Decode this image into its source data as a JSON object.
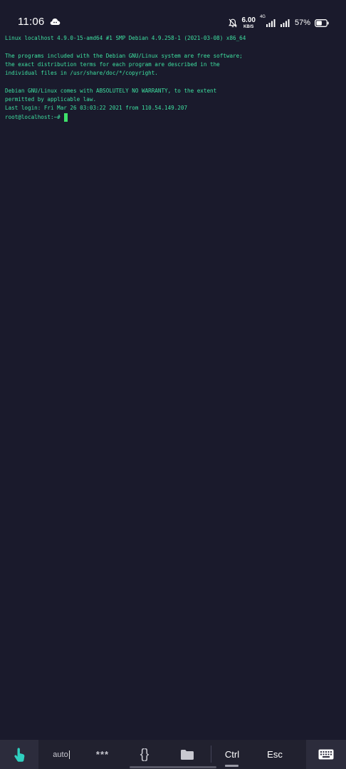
{
  "status_bar": {
    "time": "11:06",
    "net_speed_value": "6.00",
    "net_speed_unit": "KB/S",
    "network_tag": "4G",
    "battery_percent": "57%",
    "battery_level": 0.57,
    "icons": [
      "cloud-icon",
      "bell-muted-icon",
      "signal-icon",
      "signal-icon",
      "battery-icon"
    ]
  },
  "terminal": {
    "lines": [
      "Linux localhost 4.9.0-15-amd64 #1 SMP Debian 4.9.258-1 (2021-03-08) x86_64",
      "",
      "The programs included with the Debian GNU/Linux system are free software;",
      "the exact distribution terms for each program are described in the",
      "individual files in /usr/share/doc/*/copyright.",
      "",
      "Debian GNU/Linux comes with ABSOLUTELY NO WARRANTY, to the extent",
      "permitted by applicable law.",
      "Last login: Fri Mar 26 03:03:22 2021 from 110.54.149.207"
    ],
    "prompt": "root@localhost:~# ",
    "text_color": "#3ee0a0",
    "background": "#1a1a2c"
  },
  "toolbar": {
    "auto_label": "auto",
    "password_label": "***",
    "snippets_label": "{}",
    "ctrl_label": "Ctrl",
    "esc_label": "Esc",
    "icons": [
      "touch-icon",
      "folder-icon",
      "keyboard-icon"
    ]
  }
}
